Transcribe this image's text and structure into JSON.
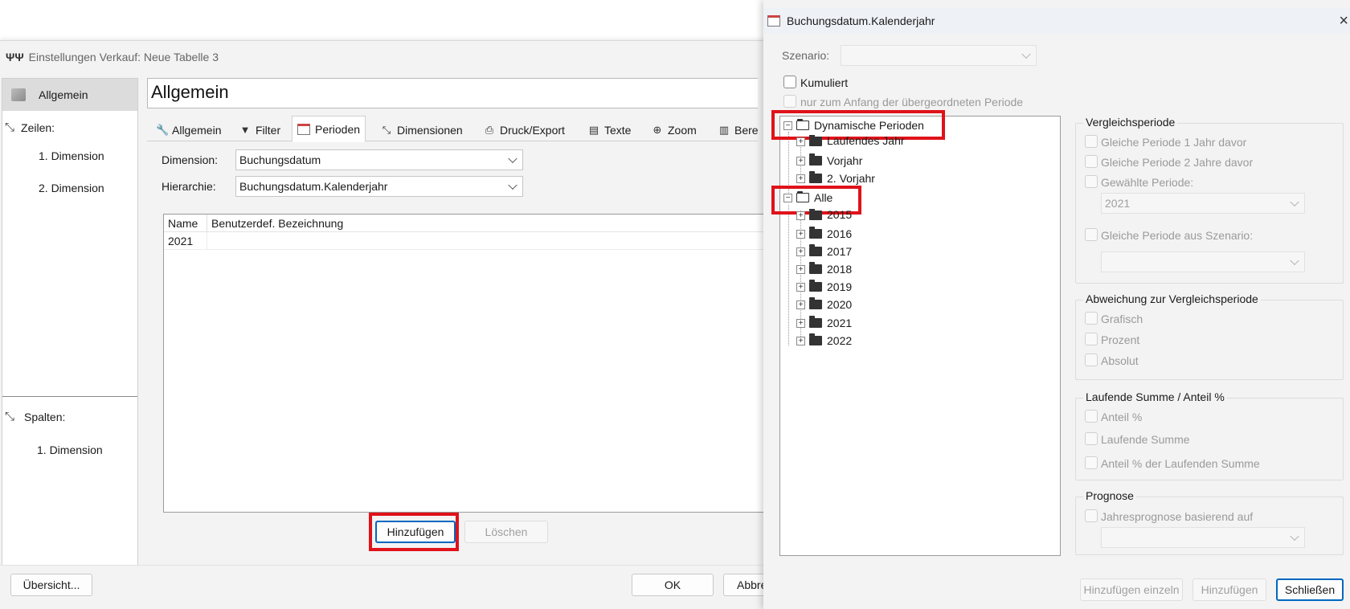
{
  "left_window": {
    "title": "Einstellungen Verkauf: Neue Tabelle 3",
    "nav": {
      "allgemein": "Allgemein",
      "zeilen": "Zeilen:",
      "zeilen_items": [
        "1. Dimension",
        "2. Dimension"
      ],
      "spalten": "Spalten:",
      "spalten_items": [
        "1. Dimension"
      ]
    },
    "heading": "Allgemein",
    "tabs": [
      "Allgemein",
      "Filter",
      "Perioden",
      "Dimensionen",
      "Druck/Export",
      "Texte",
      "Zoom",
      "Bere"
    ],
    "form": {
      "dimension_label": "Dimension:",
      "dimension_value": "Buchungsdatum",
      "hierarchie_label": "Hierarchie:",
      "hierarchie_value": "Buchungsdatum.Kalenderjahr"
    },
    "table": {
      "headers": [
        "Name",
        "Benutzerdef. Bezeichnung"
      ],
      "rows": [
        [
          "2021",
          ""
        ]
      ]
    },
    "buttons": {
      "add": "Hinzufügen",
      "delete": "Löschen",
      "overview": "Übersicht...",
      "ok": "OK",
      "cancel": "Abbre"
    }
  },
  "right_window": {
    "title": "Buchungsdatum.Kalenderjahr",
    "close": "×",
    "scenario_label": "Szenario:",
    "scenario_value": "",
    "kumuliert": "Kumuliert",
    "nur_anfang": "nur zum Anfang der übergeordneten Periode",
    "tree": {
      "dyn_root": "Dynamische Perioden",
      "dyn_children": [
        "Laufendes Jahr",
        "Vorjahr",
        "2. Vorjahr"
      ],
      "alle_root": "Alle",
      "alle_children": [
        "2015",
        "2016",
        "2017",
        "2018",
        "2019",
        "2020",
        "2021",
        "2022"
      ]
    },
    "vergleich": {
      "title": "Vergleichsperiode",
      "opt1": "Gleiche Periode 1 Jahr davor",
      "opt2": "Gleiche Periode 2 Jahre davor",
      "opt3": "Gewählte Periode:",
      "selected_period": "2021",
      "opt4": "Gleiche Periode aus Szenario:",
      "scenario_value": ""
    },
    "abweichung": {
      "title": "Abweichung zur Vergleichsperiode",
      "items": [
        "Grafisch",
        "Prozent",
        "Absolut"
      ]
    },
    "laufende": {
      "title": "Laufende Summe / Anteil %",
      "items": [
        "Anteil %",
        "Laufende Summe",
        "Anteil % der Laufenden Summe"
      ]
    },
    "prognose": {
      "title": "Prognose",
      "item": "Jahresprognose basierend auf",
      "value": ""
    },
    "buttons": {
      "add_single": "Hinzufügen einzeln",
      "add": "Hinzufügen",
      "close": "Schließen"
    }
  },
  "colors": {
    "highlight_red": "#e0121a",
    "accent_blue": "#0067c0"
  }
}
